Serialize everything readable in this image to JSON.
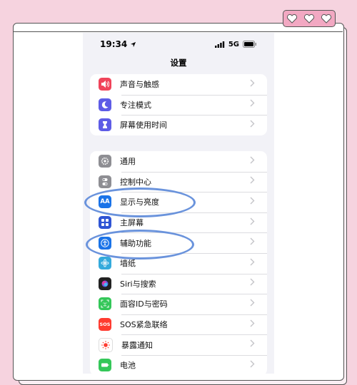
{
  "status": {
    "time": "19:34",
    "network": "5G"
  },
  "nav_title": "设置",
  "groups": [
    {
      "items": [
        {
          "label": "声音与触感",
          "icon": "speaker-icon",
          "color": "#f0445a"
        },
        {
          "label": "专注模式",
          "icon": "moon-icon",
          "color": "#5e5ce6"
        },
        {
          "label": "屏幕使用时间",
          "icon": "hourglass-icon",
          "color": "#5e5ce6"
        }
      ]
    },
    {
      "items": [
        {
          "label": "通用",
          "icon": "gear-icon",
          "color": "#8e8e93"
        },
        {
          "label": "控制中心",
          "icon": "toggles-icon",
          "color": "#8e8e93"
        },
        {
          "label": "显示与亮度",
          "icon": "text-size-icon",
          "color": "#1a73e8"
        },
        {
          "label": "主屏幕",
          "icon": "grid-icon",
          "color": "#2f55d4"
        },
        {
          "label": "辅助功能",
          "icon": "accessibility-icon",
          "color": "#1a73e8"
        },
        {
          "label": "墙纸",
          "icon": "flower-icon",
          "color": "#34aadc"
        },
        {
          "label": "Siri与搜索",
          "icon": "siri-icon",
          "color": "#222222"
        },
        {
          "label": "面容ID与密码",
          "icon": "face-id-icon",
          "color": "#34c759"
        },
        {
          "label": "SOS紧急联络",
          "icon": "sos-icon",
          "color": "#ff3b30"
        },
        {
          "label": "暴露通知",
          "icon": "exposure-icon",
          "color": "#ffffff"
        },
        {
          "label": "电池",
          "icon": "battery-icon",
          "color": "#34c759"
        }
      ]
    }
  ],
  "icon_glyphs": {
    "text-size": "AA",
    "sos": "SOS"
  },
  "annotation_color": "#6a93dc"
}
